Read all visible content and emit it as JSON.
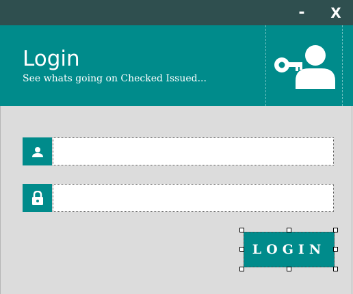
{
  "window": {
    "minimize_label": "-",
    "close_label": "X"
  },
  "header": {
    "title": "Login",
    "subtitle": "See whats going on Checked Issued...",
    "icon": "key-user-icon"
  },
  "form": {
    "username": {
      "icon": "user-icon",
      "value": ""
    },
    "password": {
      "icon": "lock-icon",
      "value": ""
    },
    "login_label": "LOGIN"
  },
  "colors": {
    "titlebar": "#2f4f4f",
    "accent": "#008b8b",
    "background": "#dcdcdc"
  }
}
